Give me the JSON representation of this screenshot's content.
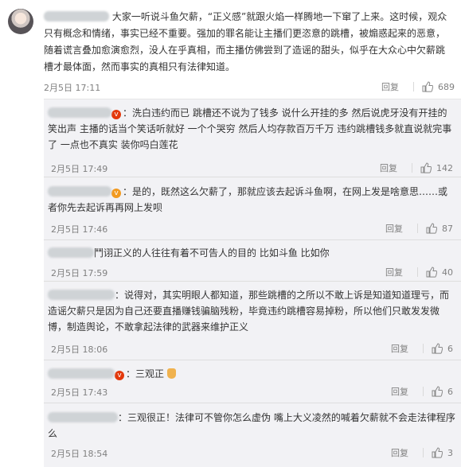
{
  "main": {
    "text": "大家一听说斗鱼欠薪，“正义感”就跟火焰一样腾地一下窜了上来。这时候，观众只有概念和情绪，事实已经不重要。强加的罪名能让主播们更恣意的跳槽，被煽惑起来的恶意，随着谎言叠加愈演愈烈，没人在乎真相，而主播仿佛尝到了造谣的甜头，似乎在大众心中欠薪跳槽才最体面，然而事实的真相只有法律知道。",
    "time": "2月5日 17:11",
    "reply_label": "回复",
    "likes": "689"
  },
  "comments": [
    {
      "text": "：洗白违约而已 跳槽还不说为了钱多 说什么开挂的多 然后说虎牙没有开挂的笑出声 主播的话当个笑话听就好 一个个哭穷 然后人均存款百万千万 违约跳槽钱多就直说就完事了 一点也不真实 装你吗白莲花",
      "time": "2月5日 17:49",
      "reply": "回复",
      "likes": "142"
    },
    {
      "text": "：是的，既然这么欠薪了，那就应该去起诉斗鱼啊，在网上发是啥意思……或者你先去起诉再再网上发呗",
      "time": "2月5日 17:46",
      "reply": "回复",
      "likes": "87"
    },
    {
      "text": "鬥诩正义的人往往有着不可告人的目的 比如斗鱼 比如你",
      "time": "2月5日 17:59",
      "reply": "回复",
      "likes": "40"
    },
    {
      "text": "：说得对，其实明眼人都知道，那些跳槽的之所以不敢上诉是知道知道理亏，而造谣欠薪只是因为自己还要直播赚钱骗脑残粉，毕竟违约跳槽容易掉粉，所以他们只敢发发微博，制造舆论，不敢拿起法律的武器来维护正义",
      "time": "2月5日 18:06",
      "reply": "回复",
      "likes": "6"
    },
    {
      "text": "：三观正",
      "time": "2月5日 17:43",
      "reply": "回复",
      "likes": "6"
    },
    {
      "text": "：三观很正！法律可不管你怎么虚伪 嘴上大义凌然的喊着欠薪就不会走法律程序么",
      "time": "2月5日 18:54",
      "reply": "回复",
      "likes": "3"
    }
  ],
  "colors": {
    "badge_orange": "#f29a1f",
    "badge_red": "#e3380b",
    "comments_bg": "#f2f2f5"
  },
  "icons": [
    "thumb-up-icon",
    "member-badge-icon",
    "clap-emoji-icon"
  ]
}
